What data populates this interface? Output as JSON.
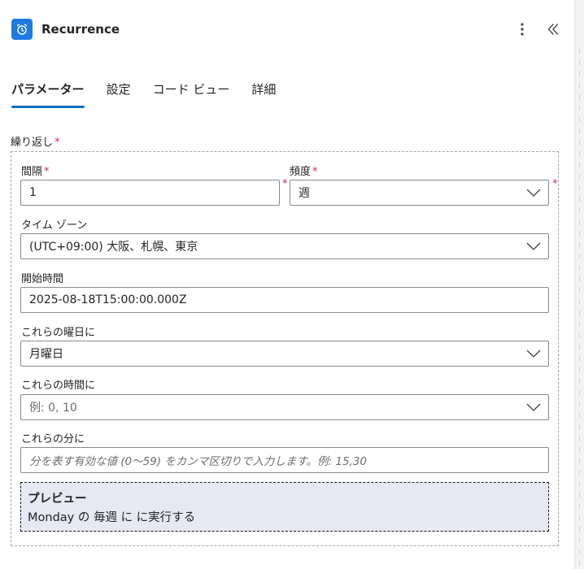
{
  "header": {
    "title": "Recurrence",
    "app_icon": "alarm-clock-icon",
    "accent": "#1f7ae0"
  },
  "tabs": [
    {
      "label": "パラメーター",
      "active": true
    },
    {
      "label": "設定"
    },
    {
      "label": "コード ビュー"
    },
    {
      "label": "詳細"
    }
  ],
  "recurrence": {
    "label": "繰り返し",
    "interval": {
      "label": "間隔",
      "value": "1"
    },
    "frequency": {
      "label": "頻度",
      "value": "週"
    },
    "timezone": {
      "label": "タイム ゾーン",
      "value": "(UTC+09:00) 大阪、札幌、東京"
    },
    "start_time": {
      "label": "開始時間",
      "value": "2025-08-18T15:00:00.000Z"
    },
    "weekdays": {
      "label": "これらの曜日に",
      "value": "月曜日"
    },
    "hours": {
      "label": "これらの時間に",
      "placeholder": "例: 0, 10"
    },
    "minutes": {
      "label": "これらの分に",
      "placeholder": "分を表す有効な値 (0〜59) をカンマ区切りで入力します。例: 15,30"
    },
    "required_mark": "*"
  },
  "preview": {
    "title": "プレビュー",
    "text": "Monday の 毎週 に に実行する"
  }
}
